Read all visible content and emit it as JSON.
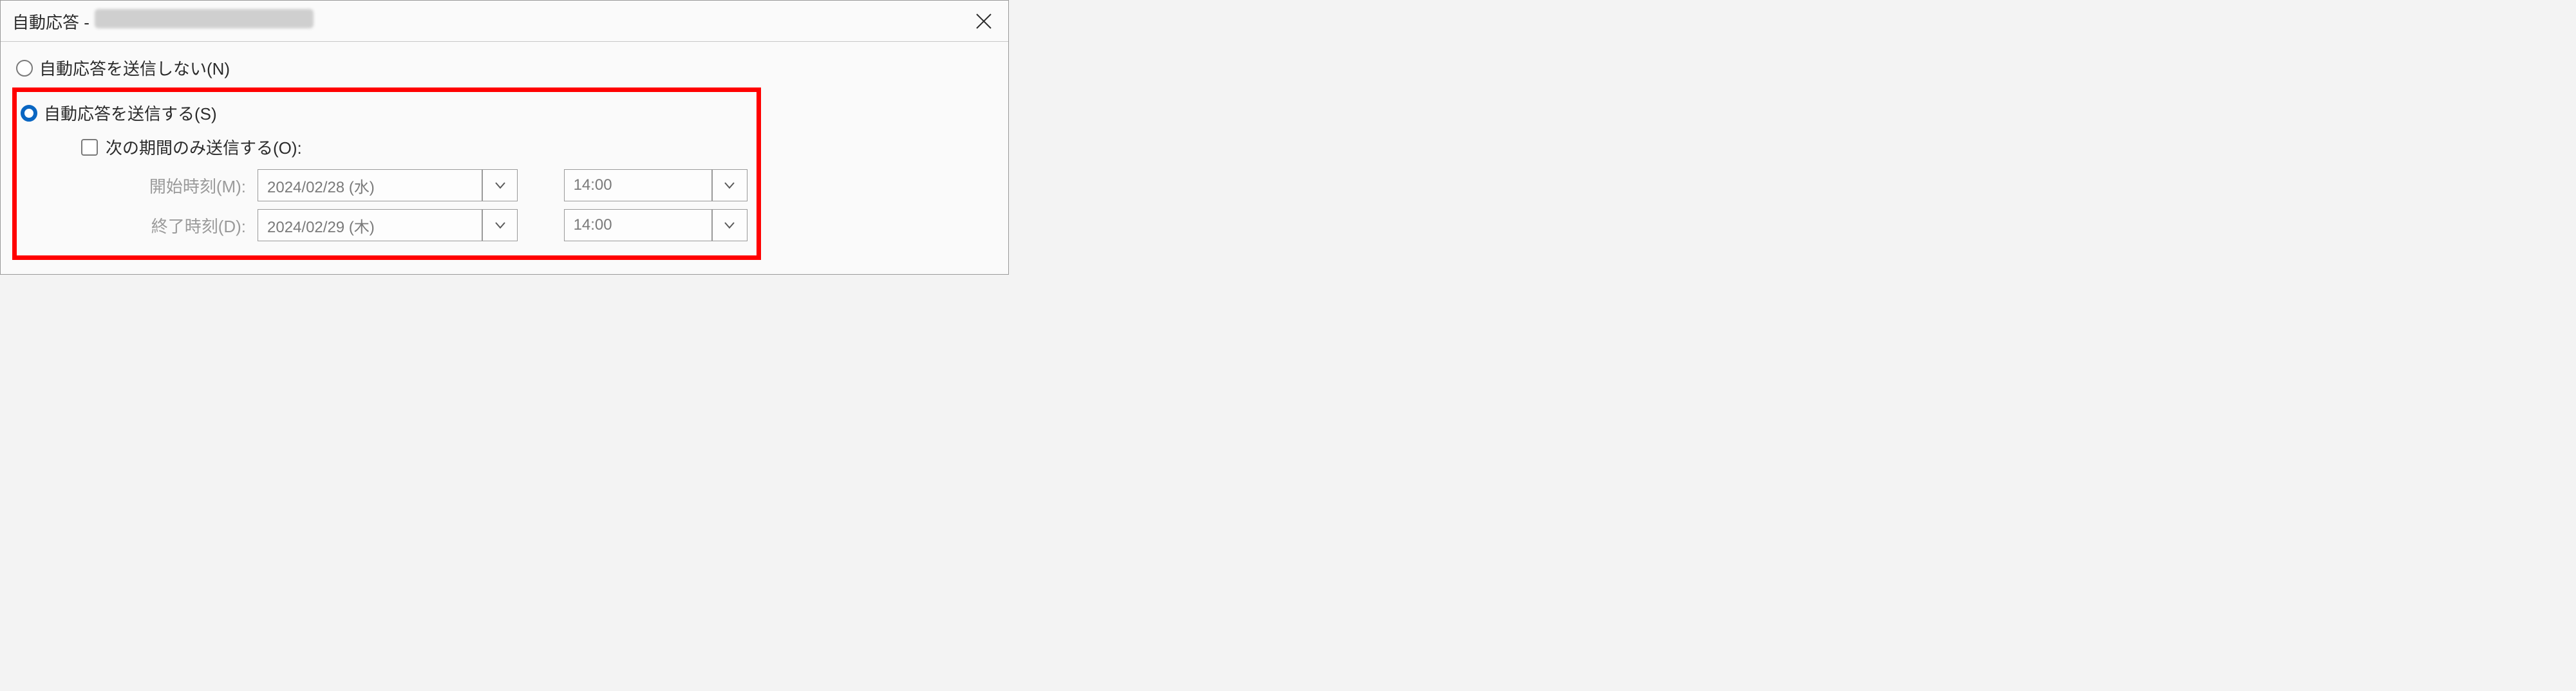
{
  "dialog": {
    "title_prefix": "自動応答 -",
    "body": {
      "radio_no_send_label": "自動応答を送信しない(N)",
      "radio_send_label": "自動応答を送信する(S)",
      "checkbox_period_label": "次の期間のみ送信する(O):",
      "start_label": "開始時刻(M):",
      "end_label": "終了時刻(D):",
      "start_date": "2024/02/28 (水)",
      "start_time": "14:00",
      "end_date": "2024/02/29 (木)",
      "end_time": "14:00"
    }
  }
}
